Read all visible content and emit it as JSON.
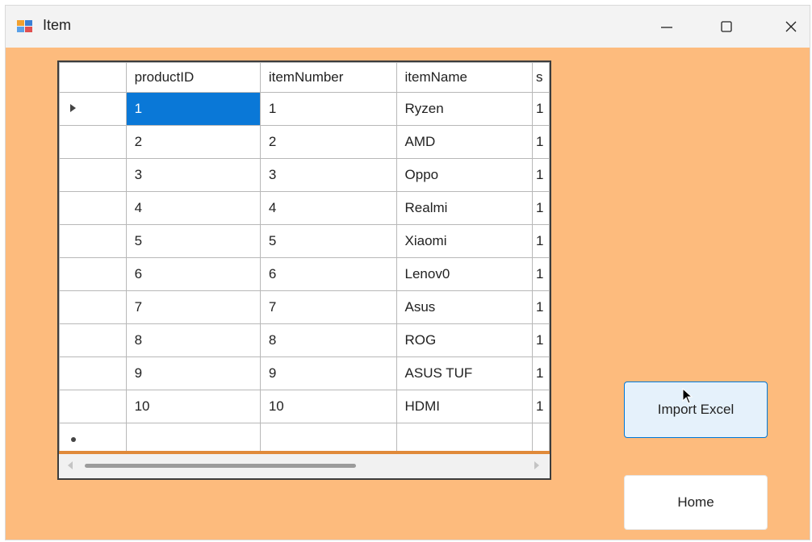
{
  "window": {
    "title": "Item",
    "controls": {
      "minimize_icon": "minimize-icon",
      "maximize_icon": "maximize-icon",
      "close_icon": "close-icon"
    }
  },
  "grid": {
    "columns": [
      "productID",
      "itemNumber",
      "itemName"
    ],
    "rows": [
      {
        "productID": "1",
        "itemNumber": "1",
        "itemName": "Ryzen",
        "next": "1"
      },
      {
        "productID": "2",
        "itemNumber": "2",
        "itemName": "AMD",
        "next": "1"
      },
      {
        "productID": "3",
        "itemNumber": "3",
        "itemName": "Oppo",
        "next": "1"
      },
      {
        "productID": "4",
        "itemNumber": "4",
        "itemName": "Realmi",
        "next": "1"
      },
      {
        "productID": "5",
        "itemNumber": "5",
        "itemName": "Xiaomi",
        "next": "1"
      },
      {
        "productID": "6",
        "itemNumber": "6",
        "itemName": "Lenov0",
        "next": "1"
      },
      {
        "productID": "7",
        "itemNumber": "7",
        "itemName": "Asus",
        "next": "1"
      },
      {
        "productID": "8",
        "itemNumber": "8",
        "itemName": "ROG",
        "next": "1"
      },
      {
        "productID": "9",
        "itemNumber": "9",
        "itemName": "ASUS TUF",
        "next": "1"
      },
      {
        "productID": "10",
        "itemNumber": "10",
        "itemName": "HDMI",
        "next": "1"
      }
    ],
    "selected_row": 0,
    "colors": {
      "selection": "#0a78d7",
      "accent": "#E08A3A",
      "form_background": "#FDBB7D"
    }
  },
  "buttons": {
    "import_label": "Import Excel",
    "home_label": "Home"
  }
}
